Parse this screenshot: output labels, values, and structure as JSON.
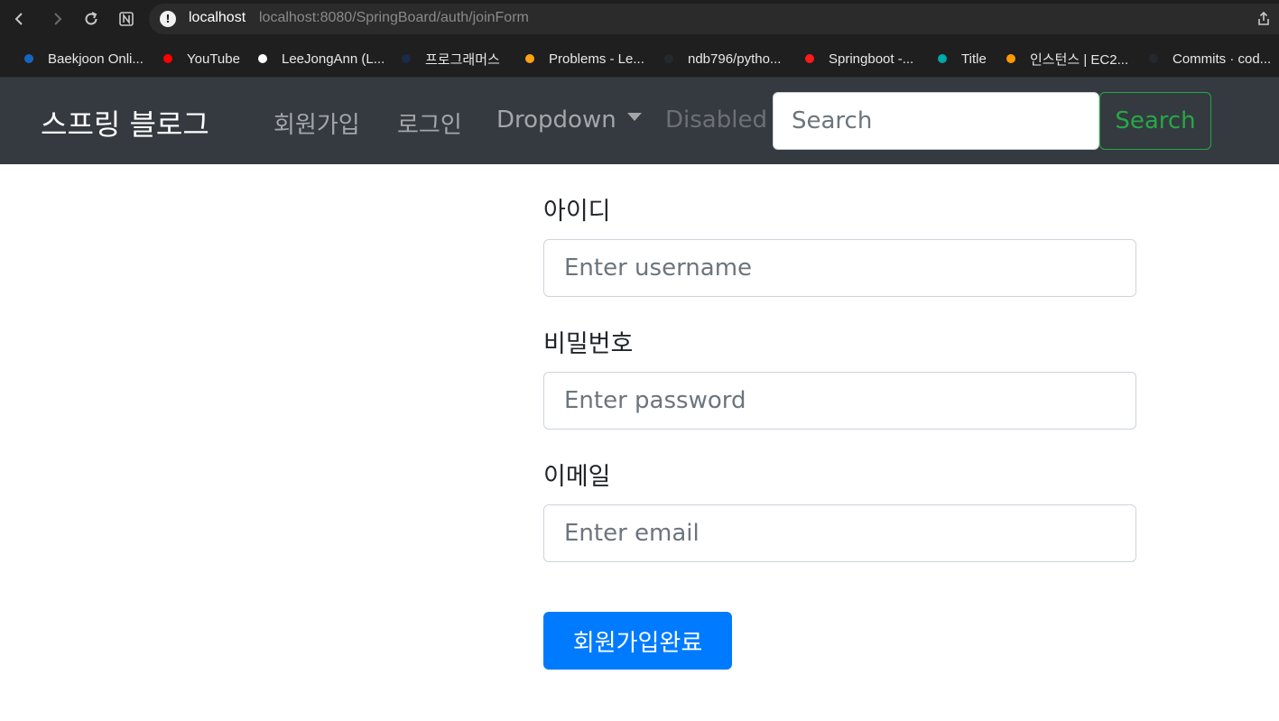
{
  "browser": {
    "host": "localhost",
    "path": "localhost:8080/SpringBoard/auth/joinForm",
    "bookmarks": [
      {
        "label": "Baekjoon Onli...",
        "color": "#1565c0"
      },
      {
        "label": "YouTube",
        "color": "#ff0000"
      },
      {
        "label": "LeeJongAnn (L...",
        "color": "#ffffff"
      },
      {
        "label": "프로그래머스",
        "color": "#1b2a4a"
      },
      {
        "label": "Problems - Le...",
        "color": "#ffa116"
      },
      {
        "label": "ndb796/pytho...",
        "color": "#24292e"
      },
      {
        "label": "Springboot -...",
        "color": "#ff1a1a"
      },
      {
        "label": "Title",
        "color": "#00a8a8"
      },
      {
        "label": "인스턴스 | EC2...",
        "color": "#ff9900"
      },
      {
        "label": "Commits · cod...",
        "color": "#24292e"
      }
    ]
  },
  "navbar": {
    "brand": "스프링 블로그",
    "links": {
      "signup": "회원가입",
      "login": "로그인",
      "dropdown": "Dropdown",
      "disabled": "Disabled"
    },
    "search_placeholder": "Search",
    "search_button": "Search"
  },
  "form": {
    "username_label": "아이디",
    "username_placeholder": "Enter username",
    "password_label": "비밀번호",
    "password_placeholder": "Enter password",
    "email_label": "이메일",
    "email_placeholder": "Enter email",
    "submit_label": "회원가입완료"
  },
  "colors": {
    "navbar_bg": "#343a40",
    "primary": "#007bff",
    "success": "#28a745"
  }
}
